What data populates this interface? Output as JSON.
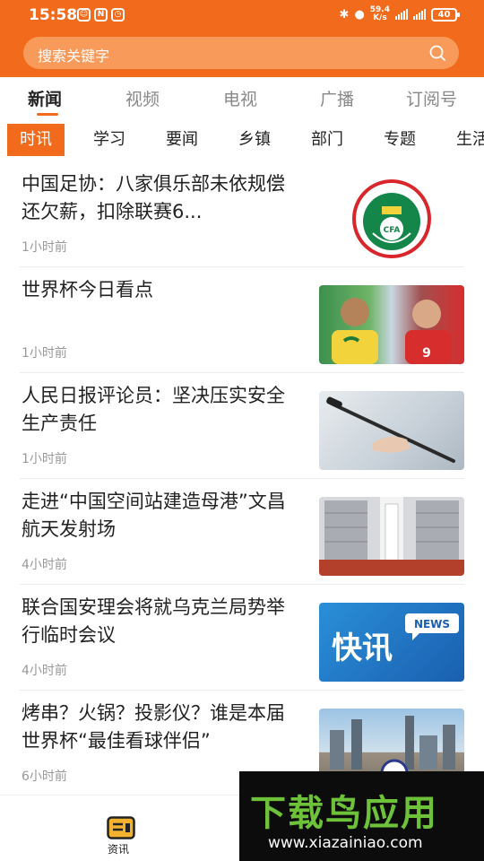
{
  "status_bar": {
    "time": "15:58",
    "speed_value": "59.4",
    "speed_unit": "K/s",
    "battery": "40"
  },
  "search": {
    "placeholder": "搜索关键字"
  },
  "main_tabs": [
    {
      "label": "新闻"
    },
    {
      "label": "视频"
    },
    {
      "label": "电视"
    },
    {
      "label": "广播"
    },
    {
      "label": "订阅号"
    }
  ],
  "sub_tabs": [
    {
      "label": "时讯"
    },
    {
      "label": "学习"
    },
    {
      "label": "要闻"
    },
    {
      "label": "乡镇"
    },
    {
      "label": "部门"
    },
    {
      "label": "专题"
    },
    {
      "label": "生活"
    }
  ],
  "news": [
    {
      "title": "中国足协：八家俱乐部未依规偿还欠薪，扣除联赛6...",
      "time": "1小时前",
      "thumb_text": "CFA"
    },
    {
      "title": "世界杯今日看点",
      "time": "1小时前",
      "thumb_text": "9"
    },
    {
      "title": "人民日报评论员：坚决压实安全生产责任",
      "time": "1小时前"
    },
    {
      "title": "走进“中国空间站建造母港”文昌航天发射场",
      "time": "4小时前"
    },
    {
      "title": "联合国安理会将就乌克兰局势举行临时会议",
      "time": "4小时前",
      "thumb_text": "快讯",
      "thumb_badge": "NEWS"
    },
    {
      "title": "烤串？火锅？投影仪？谁是本届世界杯“最佳看球伴侣”",
      "time": "6小时前"
    }
  ],
  "bottom_nav": {
    "item_label": "资讯"
  },
  "watermark": {
    "title": "下载鸟应用",
    "url": "www.xiazainiao.com"
  },
  "colors": {
    "accent": "#f26a1b",
    "watermark_green": "#6ec23a"
  }
}
